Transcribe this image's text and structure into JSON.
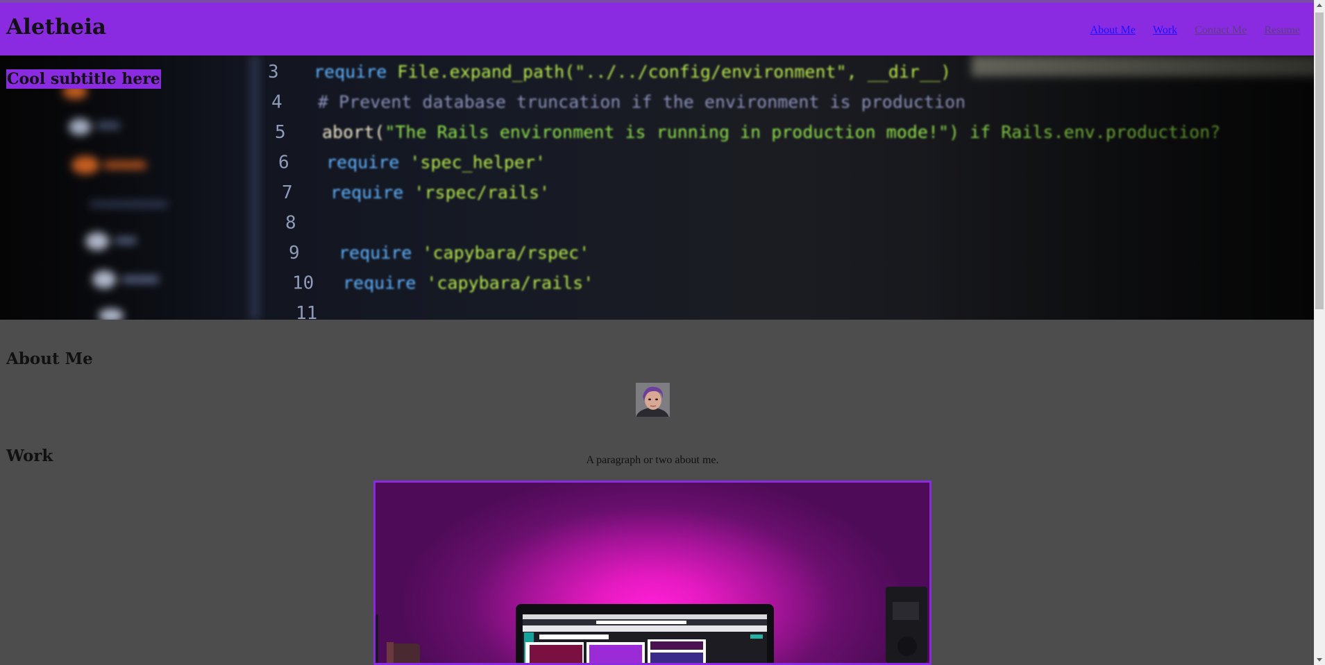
{
  "header": {
    "brand": "Aletheia",
    "nav": [
      {
        "label": "About Me"
      },
      {
        "label": "Work"
      },
      {
        "label": "Contact Me"
      },
      {
        "label": "Resume"
      }
    ]
  },
  "hero": {
    "subtitle": "Cool subtitle here",
    "code_lines": [
      {
        "num": "3",
        "text": "require File.expand_path(\"../../config/environment\", __dir__)"
      },
      {
        "num": "4",
        "text": "# Prevent database truncation if the environment is production"
      },
      {
        "num": "5",
        "text": "abort(\"The Rails environment is running in production mode!\") if Rails.env.production?"
      },
      {
        "num": "6",
        "text": "require 'spec_helper'"
      },
      {
        "num": "7",
        "text": "require 'rspec/rails'"
      },
      {
        "num": "8",
        "text": ""
      },
      {
        "num": "9",
        "text": "require 'capybara/rspec'"
      },
      {
        "num": "10",
        "text": "require 'capybara/rails'"
      },
      {
        "num": "11",
        "text": ""
      }
    ]
  },
  "about": {
    "heading": "About Me",
    "bio": "A paragraph or two about me."
  },
  "work": {
    "heading": "Work"
  },
  "colors": {
    "accent": "#8a2be2",
    "page_bg": "#4d4d4d"
  }
}
